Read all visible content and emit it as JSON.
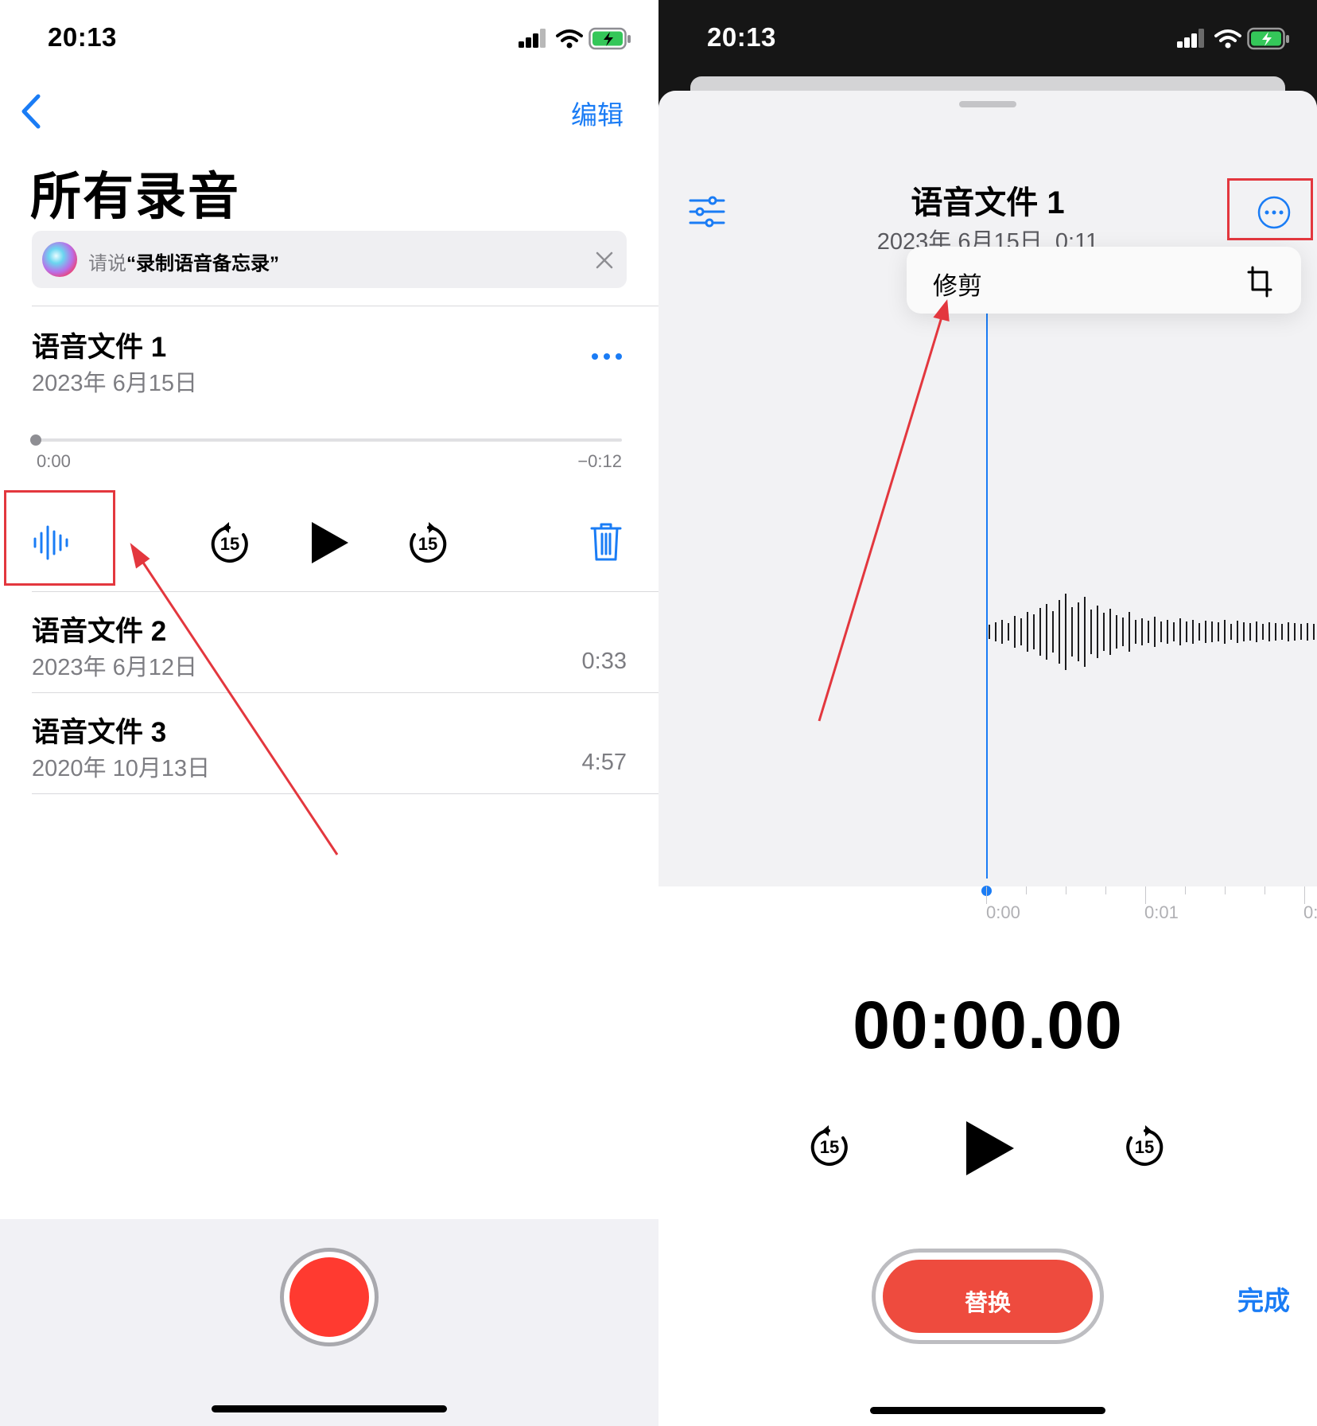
{
  "left": {
    "status": {
      "time": "20:13"
    },
    "nav": {
      "edit": "编辑"
    },
    "title": "所有录音",
    "siri": {
      "prefix": "请说",
      "phrase": "“录制语音备忘录”"
    },
    "recordings": [
      {
        "title": "语音文件 1",
        "date": "2023年 6月15日"
      },
      {
        "title": "语音文件 2",
        "date": "2023年 6月12日",
        "duration": "0:33"
      },
      {
        "title": "语音文件 3",
        "date": "2020年 10月13日",
        "duration": "4:57"
      }
    ],
    "player": {
      "elapsed": "0:00",
      "remaining": "−0:12",
      "skip_back": "15",
      "skip_forward": "15",
      "progress": 0
    }
  },
  "right": {
    "status": {
      "time": "20:13"
    },
    "recording": {
      "title": "语音文件 1",
      "date": "2023年 6月15日",
      "duration": "0:11"
    },
    "menu": {
      "trim": "修剪"
    },
    "timeline": {
      "ticks": [
        "0:00",
        "0:01",
        "0:"
      ]
    },
    "timer": "00:00.00",
    "controls": {
      "skip_back": "15",
      "skip_forward": "15"
    },
    "replace": "替换",
    "done": "完成"
  },
  "colors": {
    "accent": "#1a7cf5",
    "record": "#ff3a30",
    "replace": "#ee4b3e",
    "annotation": "#e3373e"
  }
}
